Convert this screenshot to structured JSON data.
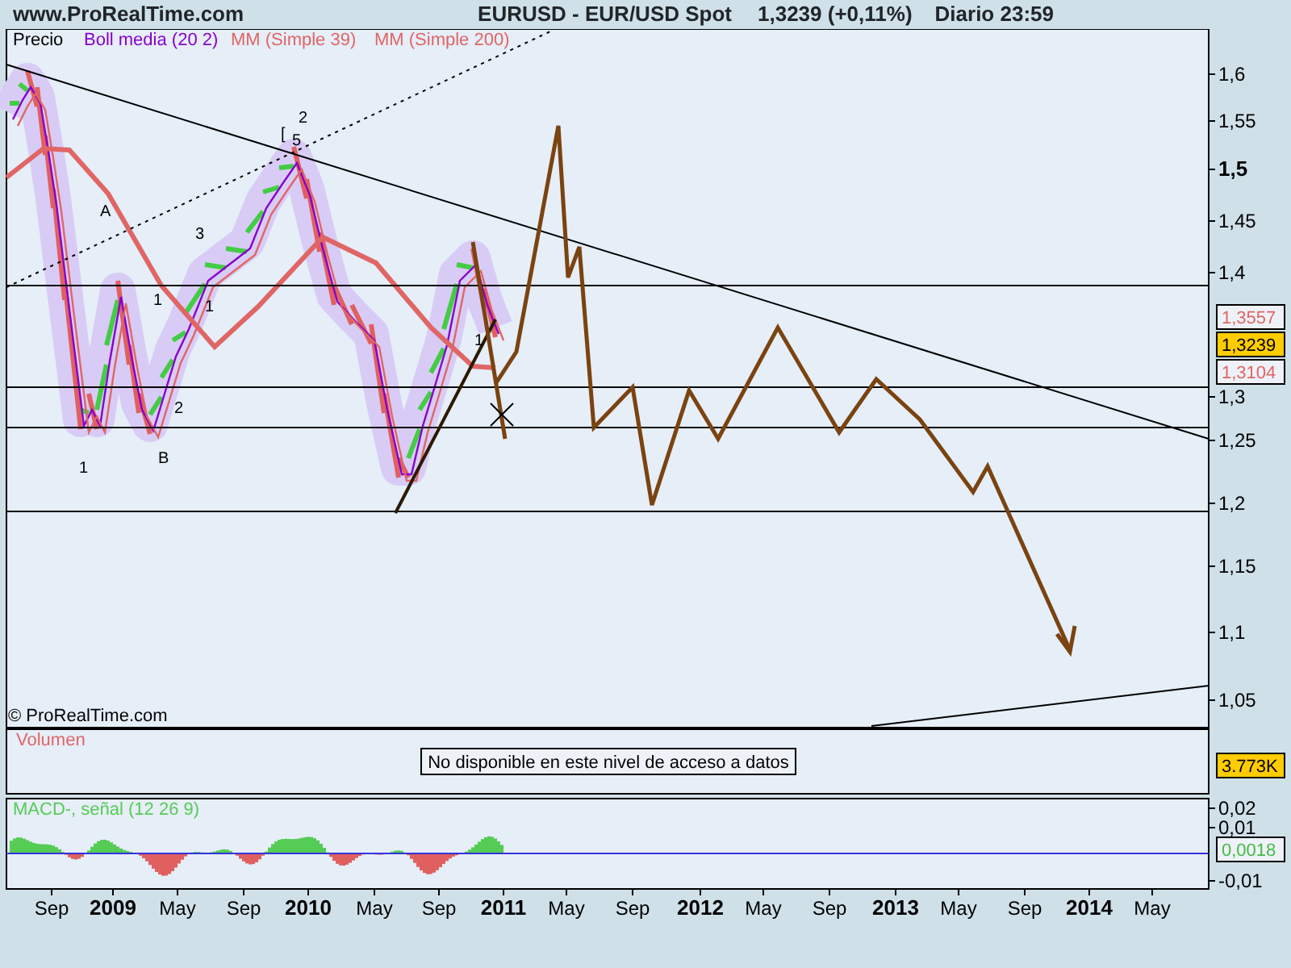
{
  "header": {
    "site": "www.ProRealTime.com",
    "title": "EURUSD - EUR/USD Spot",
    "quote": "1,3239 (+0,11%)",
    "timeframe": "Diario  23:59"
  },
  "price_panel": {
    "legend": [
      {
        "label": "Precio",
        "color": "#000000"
      },
      {
        "label": "Boll media (20 2)",
        "color": "#8800cc"
      },
      {
        "label": "MM (Simple 39)",
        "color": "#e06666"
      },
      {
        "label": "MM (Simple 200)",
        "color": "#e06666"
      }
    ],
    "wave_labels": [
      "A",
      "1",
      "1",
      "3",
      "1",
      "2",
      "B",
      "[",
      "5",
      "2",
      "1"
    ],
    "copyright": "© ProRealTime.com",
    "y_axis": [
      {
        "label": "1,6",
        "bold": false
      },
      {
        "label": "1,55",
        "bold": false
      },
      {
        "label": "1,5",
        "bold": true
      },
      {
        "label": "1,45",
        "bold": false
      },
      {
        "label": "1,4",
        "bold": false
      },
      {
        "label": "1,3",
        "bold": false
      },
      {
        "label": "1,25",
        "bold": false
      },
      {
        "label": "1,2",
        "bold": false
      },
      {
        "label": "1,15",
        "bold": false
      },
      {
        "label": "1,1",
        "bold": false
      },
      {
        "label": "1,05",
        "bold": false
      }
    ],
    "badges": [
      {
        "kind": "average",
        "value": "1,3557"
      },
      {
        "kind": "last",
        "value": "1,3239"
      },
      {
        "kind": "average",
        "value": "1,3104"
      }
    ]
  },
  "volume_panel": {
    "title": "Volumen",
    "message": "No disponible en este nivel de acceso a datos",
    "badge": "3.773K"
  },
  "macd_panel": {
    "title": "MACD-, señal (12 26 9)",
    "y_axis": [
      "0,02",
      "0,01",
      "-0,01"
    ],
    "badge": "0,0018"
  },
  "x_axis": [
    {
      "label": "Sep",
      "kind": "month"
    },
    {
      "label": "2009",
      "kind": "year"
    },
    {
      "label": "May",
      "kind": "month"
    },
    {
      "label": "Sep",
      "kind": "month"
    },
    {
      "label": "2010",
      "kind": "year"
    },
    {
      "label": "May",
      "kind": "month"
    },
    {
      "label": "Sep",
      "kind": "month"
    },
    {
      "label": "2011",
      "kind": "year"
    },
    {
      "label": "May",
      "kind": "month"
    },
    {
      "label": "Sep",
      "kind": "month"
    },
    {
      "label": "2012",
      "kind": "year"
    },
    {
      "label": "May",
      "kind": "month"
    },
    {
      "label": "Sep",
      "kind": "month"
    },
    {
      "label": "2013",
      "kind": "year"
    },
    {
      "label": "May",
      "kind": "month"
    },
    {
      "label": "Sep",
      "kind": "month"
    },
    {
      "label": "2014",
      "kind": "year"
    },
    {
      "label": "May",
      "kind": "month"
    }
  ]
}
